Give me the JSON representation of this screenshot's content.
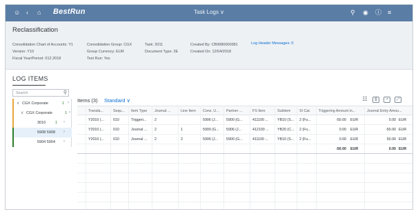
{
  "shell": {
    "logo": "BestRun",
    "title": "Task Logs ∨",
    "icons": [
      "user-icon",
      "back-icon",
      "home-icon",
      "search-icon",
      "bell-icon",
      "help-icon",
      "menu-icon"
    ]
  },
  "header": {
    "title": "Reclassification",
    "col1": [
      "Consolidation Chart of Accounts: Y1",
      "Version: Y10",
      "Fiscal Year/Period: 012.2018"
    ],
    "col2": [
      "Consolidation Group: CGX",
      "Group Currency: EUR",
      "Test Run: Yes"
    ],
    "col3": [
      "Task: 2011",
      "Document Type: 2E"
    ],
    "col4": [
      "Created By: CB9980000381",
      "Created On: 12/04/2018"
    ],
    "link": "Log Header Messages: 0"
  },
  "section": {
    "title": "LOG ITEMS"
  },
  "tree": {
    "search_placeholder": "Search",
    "nodes": [
      {
        "label": "CGX Corporate",
        "count": "1",
        "chev": "›",
        "exp": "∨"
      },
      {
        "label": "CGX Corporate",
        "count": "1",
        "chev": "›",
        "exp": "∨"
      },
      {
        "label": "3010",
        "count": "1",
        "chev": "›"
      },
      {
        "label": "5908 5908",
        "count": "",
        "chev": "›"
      },
      {
        "label": "5904 5904",
        "count": "",
        "chev": "›"
      }
    ]
  },
  "table": {
    "title": "Items (3)",
    "variant": "Standard ∨",
    "headers": [
      "Transla...",
      "Sequ...",
      "Item Type",
      "Journal ...",
      "Line Item",
      "Cons. U...",
      "Partner ...",
      "FS Item",
      "Subitem",
      "SI Cat.",
      "Triggering Amount in...",
      "Journal Entry Amou..."
    ],
    "rows": [
      [
        "Y2010 (...",
        "010",
        "Triggeri...",
        "2",
        "",
        "5906 (J...",
        "5900 (G...",
        "411100 ...",
        "YB10 (S...",
        "2 (Fu...",
        "-50.00",
        "EUR",
        "0.00",
        "EUR"
      ],
      [
        "Y2010 (...",
        "010",
        "Journal ...",
        "2",
        "1",
        "5900 (G...",
        "5906 (J...",
        "412100 ...",
        "YB20 (C...",
        "2 (Fu...",
        "0.00",
        "EUR",
        "-50.00",
        "EUR"
      ],
      [
        "Y2010 (...",
        "010",
        "Journal ...",
        "2",
        "2",
        "5906 (J...",
        "5900 (G...",
        "411100 ...",
        "YB10 (S...",
        "2 (Fu...",
        "0.00",
        "EUR",
        "50.00",
        "EUR"
      ]
    ],
    "total": [
      "-50.00",
      "EUR",
      "0.00",
      "EUR"
    ]
  }
}
